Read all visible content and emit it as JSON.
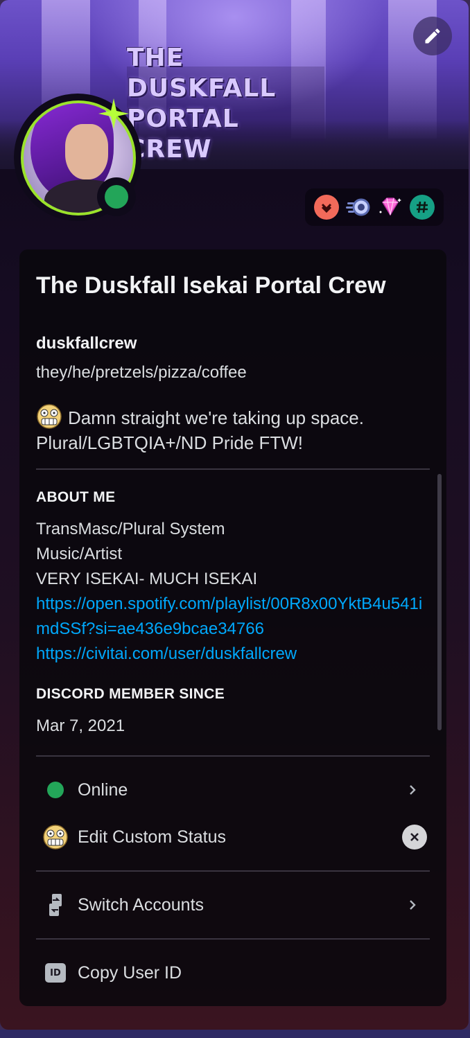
{
  "banner": {
    "logo_line1": "THE DUSKFALL",
    "logo_line2": "PORTAL CREW"
  },
  "badges": [
    "nitro-boost-badge",
    "server-booster-badge",
    "nitro-gem-badge",
    "hashtag-badge"
  ],
  "profile": {
    "display_name": "The Duskfall Isekai Portal Crew",
    "username": "duskfallcrew",
    "pronouns": "they/he/pretzels/pizza/coffee",
    "custom_status": "Damn straight we're taking up space. Plural/LGBTQIA+/ND Pride FTW!"
  },
  "about": {
    "title": "ABOUT ME",
    "lines": [
      "TransMasc/Plural System",
      "Music/Artist",
      "VERY ISEKAI- MUCH ISEKAI"
    ],
    "links": [
      "https://open.spotify.com/playlist/00R8x00YktB4u541imdSSf?si=ae436e9bcae34766",
      "https://civitai.com/user/duskfallcrew"
    ]
  },
  "member": {
    "title": "DISCORD MEMBER SINCE",
    "date": "Mar 7, 2021"
  },
  "menu": {
    "status_label": "Online",
    "custom_status_label": "Edit Custom Status",
    "switch_accounts_label": "Switch Accounts",
    "copy_id_label": "Copy User ID",
    "id_icon_text": "ID"
  },
  "colors": {
    "online": "#23a559",
    "link": "#00a8fc",
    "avatar_ring": "#9be32b"
  }
}
